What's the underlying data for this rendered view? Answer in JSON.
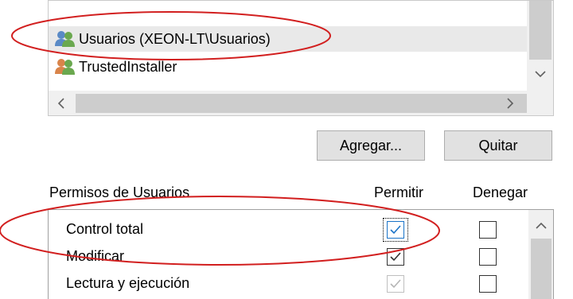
{
  "principals": [
    {
      "label": "Usuarios (XEON-LT\\Usuarios)",
      "icon": "user-group-icon",
      "selected": true
    },
    {
      "label": "TrustedInstaller",
      "icon": "user-group-icon",
      "selected": false
    }
  ],
  "buttons": {
    "add": "Agregar...",
    "remove": "Quitar"
  },
  "permissions": {
    "title": "Permisos de Usuarios",
    "allow_header": "Permitir",
    "deny_header": "Denegar",
    "rows": [
      {
        "name": "Control total",
        "allow": true,
        "deny": false,
        "allow_inherited": false
      },
      {
        "name": "Modificar",
        "allow": true,
        "deny": false,
        "allow_inherited": false
      },
      {
        "name": "Lectura y ejecución",
        "allow": true,
        "deny": false,
        "allow_inherited": true
      }
    ]
  },
  "annotation_color": "#d21f1f"
}
